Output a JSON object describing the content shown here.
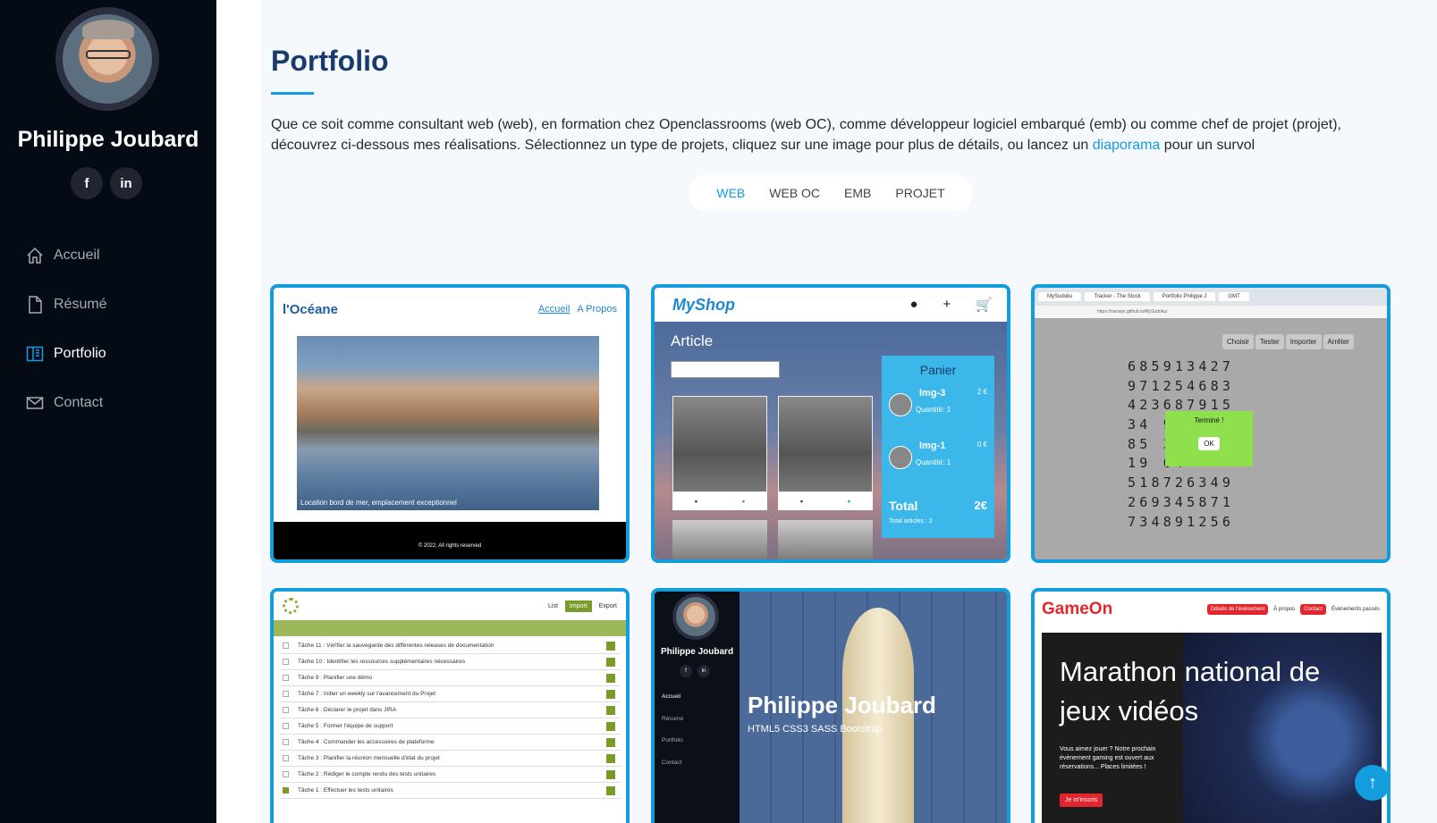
{
  "sidebar": {
    "name": "Philippe Joubard",
    "socials": [
      {
        "icon": "facebook-icon",
        "label": "f"
      },
      {
        "icon": "linkedin-icon",
        "label": "in"
      }
    ],
    "nav": [
      {
        "label": "Accueil",
        "icon": "home-icon",
        "active": false
      },
      {
        "label": "Résumé",
        "icon": "file-icon",
        "active": false
      },
      {
        "label": "Portfolio",
        "icon": "portfolio-icon",
        "active": true
      },
      {
        "label": "Contact",
        "icon": "envelope-icon",
        "active": false
      }
    ]
  },
  "main": {
    "title": "Portfolio",
    "intro_before": "Que ce soit comme consultant web (web), en formation chez Openclassrooms (web OC), comme développeur logiciel embarqué (emb) ou comme chef de projet (projet), découvrez ci-dessous mes réalisations. Sélectionnez un type de projets, cliquez sur une image pour plus de détails, ou lancez un ",
    "intro_link": "diaporama",
    "intro_after": " pour un survol",
    "filters": [
      "WEB",
      "WEB OC",
      "EMB",
      "PROJET"
    ],
    "active_filter": "WEB"
  },
  "cards": {
    "oceane": {
      "logo": "l'Océane",
      "links": [
        "Accueil",
        "A Propos"
      ],
      "caption": "Location bord de mer, emplacement exceptionnel",
      "footer": "© 2022, All rights reserved"
    },
    "myshop": {
      "logo": "MyShop",
      "article": "Article",
      "panier": "Panier",
      "items": [
        {
          "name": "Img-3",
          "price": "2 €",
          "qty": "Quantité: 1"
        },
        {
          "name": "Img-1",
          "price": "0 €",
          "qty": "Quantité: 1"
        }
      ],
      "total_label": "Total",
      "total_value": "2€",
      "total_articles": "Total articles : 2"
    },
    "sudoku": {
      "tabs": [
        "MySudoku",
        "Tracker - The Stock",
        "Portfolio Philippe J",
        "GMT"
      ],
      "url": "https://meraier.github.io/MySudoku/",
      "buttons": [
        "Choisir",
        "Tester",
        "Importer",
        "Arrêter"
      ],
      "grid": [
        "685913427",
        "971254683",
        "423687915",
        "34 98",
        "85 32",
        "19 64",
        "518726349",
        "269345871",
        "734891256"
      ],
      "modal_text": "Terminé !",
      "modal_ok": "OK"
    },
    "todo": {
      "menu": [
        "List",
        "Import",
        "Export"
      ],
      "tasks": [
        {
          "label": "Tâche 11 : Vérifier la sauvegarde des différentes releases de documentation",
          "checked": false
        },
        {
          "label": "Tâche 10 : Identifier les ressources supplémentaires nécessaires",
          "checked": false
        },
        {
          "label": "Tâche 9 : Planifier une démo",
          "checked": false
        },
        {
          "label": "Tâche 7 : Initier un weekly sur l'avancement du Projet",
          "checked": false
        },
        {
          "label": "Tâche 6 : Déclarer le projet dans JIRA",
          "checked": false
        },
        {
          "label": "Tâche 5 : Former l'équipe de support",
          "checked": false
        },
        {
          "label": "Tâche 4 : Commander les accessoires de plateforme",
          "checked": false
        },
        {
          "label": "Tâche 3 : Planifier la réunion mensuelle d'état du projet",
          "checked": false
        },
        {
          "label": "Tâche 2 : Rédiger le compte rendu des tests unitaires",
          "checked": false
        },
        {
          "label": "Tâche 1 : Effectuer les tests unitaires",
          "checked": true
        }
      ]
    },
    "profile": {
      "name": "Philippe Joubard",
      "nav": [
        "Accueil",
        "Résumé",
        "Portfolio",
        "Contact"
      ],
      "title": "Philippe Joubard",
      "subtitle": "HTML5 CSS3 SASS Bootstrap"
    },
    "gameon": {
      "logo": "GameOn",
      "menu": [
        "Détails de l'évènement",
        "À propos",
        "Contact",
        "Évènements passés"
      ],
      "headline": "Marathon national de jeux vidéos",
      "text": "Vous aimez jouer ? Notre prochain évènement gaming est ouvert aux réservations... Places limitées !",
      "cta": "Je m'inscris"
    }
  },
  "back_to_top": "↑",
  "colors": {
    "accent": "#149ddd",
    "sidebar_bg": "#040b14",
    "title": "#173b6c"
  }
}
